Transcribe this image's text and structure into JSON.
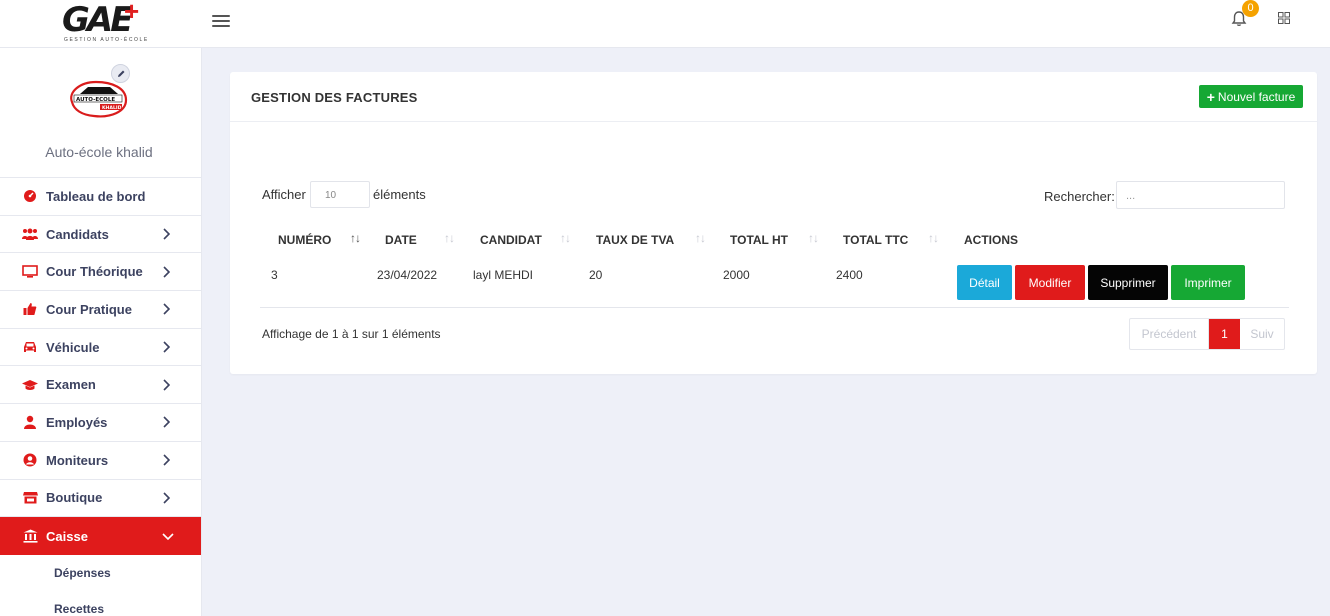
{
  "topbar": {
    "logo_text": "GAE",
    "logo_plus": "+",
    "logo_tagline": "GESTION AUTO-ÉCOLE",
    "notification_count": "0"
  },
  "sidebar": {
    "school_name": "Auto-école khalid",
    "school_logo_text": "AUTO-ECOLE KHALID",
    "items": [
      {
        "label": "Tableau de bord",
        "icon": "dashboard-icon"
      },
      {
        "label": "Candidats",
        "icon": "users-icon"
      },
      {
        "label": "Cour Théorique",
        "icon": "monitor-icon"
      },
      {
        "label": "Cour Pratique",
        "icon": "thumbs-up-icon"
      },
      {
        "label": "Véhicule",
        "icon": "car-icon"
      },
      {
        "label": "Examen",
        "icon": "graduation-cap-icon"
      },
      {
        "label": "Employés",
        "icon": "user-icon"
      },
      {
        "label": "Moniteurs",
        "icon": "user-circle-icon"
      },
      {
        "label": "Boutique",
        "icon": "store-icon"
      },
      {
        "label": "Caisse",
        "icon": "bank-icon"
      }
    ],
    "submenu": [
      "Dépenses",
      "Recettes"
    ]
  },
  "card": {
    "title": "GESTION DES FACTURES",
    "new_button": "Nouvel facture",
    "show_label": "Afficher",
    "page_length": "10",
    "elements_label": "éléments",
    "search_label": "Rechercher:",
    "search_placeholder": "...",
    "columns": [
      "NUMÉRO",
      "DATE",
      "CANDIDAT",
      "TAUX DE TVA",
      "TOTAL HT",
      "TOTAL TTC",
      "ACTIONS"
    ],
    "rows": [
      {
        "numero": "3",
        "date": "23/04/2022",
        "candidat": "layl MEHDI",
        "tva": "20",
        "total_ht": "2000",
        "total_ttc": "2400"
      }
    ],
    "actions": {
      "detail": "Détail",
      "modifier": "Modifier",
      "supprimer": "Supprimer",
      "imprimer": "Imprimer"
    },
    "info": "Affichage de 1 à 1 sur 1 éléments",
    "pager": {
      "prev": "Précédent",
      "current": "1",
      "next": "Suiv"
    }
  },
  "colors": {
    "accent_red": "#e01b1b",
    "green": "#16a834",
    "blue": "#1ba9d9",
    "background": "#eef0f8"
  }
}
